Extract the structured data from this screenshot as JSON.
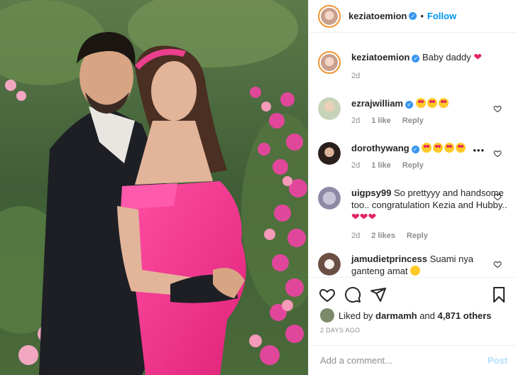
{
  "post": {
    "username": "keziatoemion",
    "follow_label": "Follow",
    "separator": "•",
    "caption": {
      "username": "keziatoemion",
      "text": "Baby daddy",
      "time": "2d"
    }
  },
  "comments": [
    {
      "username": "ezrajwilliam",
      "text": "",
      "emoji": [
        "heart-eyes",
        "heart-eyes",
        "heart-eyes"
      ],
      "time": "2d",
      "likes": "1 like",
      "reply": "Reply"
    },
    {
      "username": "dorothywang",
      "text": "",
      "emoji": [
        "heart-eyes",
        "heart-eyes",
        "heart-eyes",
        "heart-eyes"
      ],
      "time": "2d",
      "likes": "1 like",
      "reply": "Reply"
    },
    {
      "username": "uigpsy99",
      "text": "So prettyyy and handsome too.. congratulation Kezia and Hubby..",
      "time": "2d",
      "likes": "2 likes",
      "reply": "Reply"
    },
    {
      "username": "jamudietprincess",
      "text": "Suami nya ganteng amat",
      "time": "",
      "likes": "",
      "reply": ""
    }
  ],
  "likes_line": {
    "prefix": "Liked by",
    "user": "darmamh",
    "conj": "and",
    "others": "4,871 others"
  },
  "timestamp": "2 DAYS AGO",
  "add_comment": {
    "placeholder": "Add a comment...",
    "post_label": "Post"
  },
  "colors": {
    "accent": "#0095f6",
    "post_disabled": "#b2dffc",
    "heart": "#e0245e",
    "dress": "#f03c8e"
  }
}
